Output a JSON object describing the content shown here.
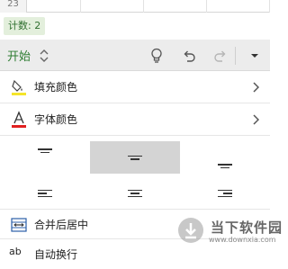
{
  "sheet": {
    "row_number": "23"
  },
  "status": {
    "count_text": "计数: 2"
  },
  "toolbar": {
    "tab_label": "开始",
    "icons": [
      "lightbulb-icon",
      "undo-icon",
      "redo-icon",
      "dropdown-icon"
    ]
  },
  "menu": {
    "fill_color": {
      "label": "填充颜色",
      "swatch": "#f5e52a"
    },
    "font_color": {
      "label": "字体颜色",
      "swatch": "#e02020"
    },
    "merge_center": {
      "label": "合并后居中"
    },
    "wrap_text": {
      "label": "自动换行",
      "icon_text": "ab"
    }
  },
  "alignment": {
    "selected": "middle-center",
    "options": [
      "top-center",
      "middle-center",
      "bottom-center",
      "left",
      "center",
      "right"
    ]
  },
  "watermark": {
    "brand": "当下软件园",
    "url": "www.downxia.com"
  },
  "colors": {
    "accent": "#2e7d32",
    "toolbar_bg": "#ececec",
    "badge_bg": "#e3efdc"
  }
}
